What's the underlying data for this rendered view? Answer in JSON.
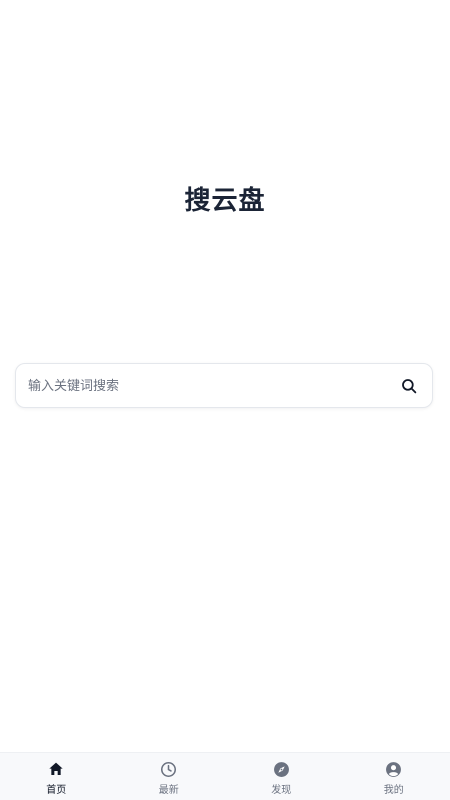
{
  "app": {
    "title": "搜云盘"
  },
  "search": {
    "placeholder": "输入关键词搜索",
    "value": "",
    "icon": "search-icon"
  },
  "tabbar": {
    "items": [
      {
        "label": "首页",
        "icon": "home-icon",
        "active": true
      },
      {
        "label": "最新",
        "icon": "clock-icon",
        "active": false
      },
      {
        "label": "发现",
        "icon": "compass-icon",
        "active": false
      },
      {
        "label": "我的",
        "icon": "user-icon",
        "active": false
      }
    ]
  },
  "colors": {
    "title": "#1b2436",
    "active_tab": "#111827",
    "inactive_tab": "#6b7280",
    "tabbar_bg": "#f8f9fb"
  }
}
